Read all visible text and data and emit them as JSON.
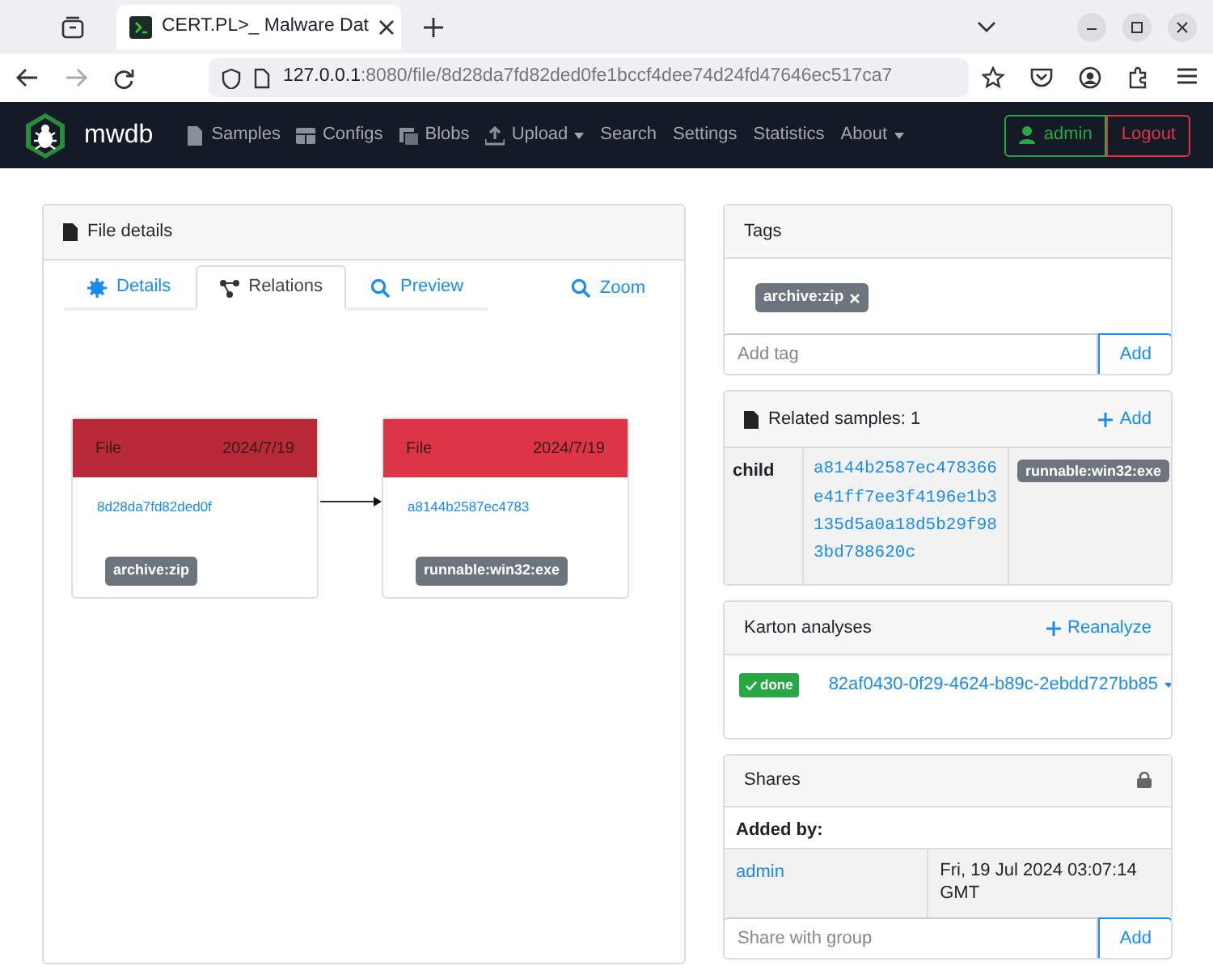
{
  "browser": {
    "tab_title": "CERT.PL>_ Malware Dat",
    "url_host": "127.0.0.1",
    "url_rest": ":8080/file/8d28da7fd82ded0fe1bccf4dee74d24fd47646ec517ca7"
  },
  "navbar": {
    "brand": "mwdb",
    "items": [
      {
        "label": "Samples",
        "kind": "samples",
        "dropdown": false
      },
      {
        "label": "Configs",
        "kind": "configs",
        "dropdown": false
      },
      {
        "label": "Blobs",
        "kind": "blobs",
        "dropdown": false
      },
      {
        "label": "Upload",
        "kind": "upload",
        "dropdown": true
      },
      {
        "label": "Search",
        "kind": "plain",
        "dropdown": false
      },
      {
        "label": "Settings",
        "kind": "plain",
        "dropdown": false
      },
      {
        "label": "Statistics",
        "kind": "plain",
        "dropdown": false
      },
      {
        "label": "About",
        "kind": "plain",
        "dropdown": true
      }
    ],
    "user": "admin",
    "logout": "Logout"
  },
  "file_details": {
    "title": "File details",
    "tabs": [
      {
        "label": "Details",
        "kind": "details",
        "selected": false
      },
      {
        "label": "Relations",
        "kind": "relations",
        "selected": true
      },
      {
        "label": "Preview",
        "kind": "preview",
        "selected": false
      }
    ],
    "zoom": "Zoom",
    "graph": {
      "nodes": [
        {
          "type": "File",
          "date": "2024/7/19",
          "hash": "8d28da7fd82ded0f",
          "tag": "archive:zip",
          "current": true
        },
        {
          "type": "File",
          "date": "2024/7/19",
          "hash": "a8144b2587ec4783",
          "tag": "runnable:win32:exe",
          "current": false
        }
      ]
    }
  },
  "tags": {
    "title": "Tags",
    "items": [
      {
        "label": "archive:zip"
      }
    ],
    "placeholder": "Add tag",
    "button": "Add"
  },
  "related": {
    "title": "Related samples: 1",
    "add": "Add",
    "rows": [
      {
        "relation": "child",
        "hash": "a8144b2587ec478366e41ff7ee3f4196e1b3135d5a0a18d5b29f983bd788620c",
        "tag": "runnable:win32:exe"
      }
    ]
  },
  "karton": {
    "title": "Karton analyses",
    "action": "Reanalyze",
    "rows": [
      {
        "status": "done",
        "id": "82af0430-0f29-4624-b89c-2ebdd727bb85"
      }
    ]
  },
  "shares": {
    "title": "Shares",
    "header": "Added by:",
    "rows": [
      {
        "user": "admin",
        "date": "Fri, 19 Jul 2024 03:07:14 GMT"
      }
    ],
    "placeholder": "Share with group",
    "button": "Add"
  }
}
